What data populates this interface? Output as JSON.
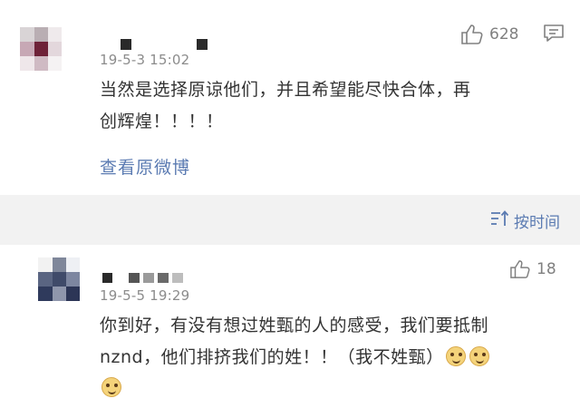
{
  "comments": [
    {
      "time": "19-5-3 15:02",
      "like_count": "628",
      "text_line1": "当然是选择原谅他们，并且希望能尽快合体，再",
      "text_line2": "创辉煌！！！！",
      "view_original_label": "查看原微博"
    },
    {
      "time": "19-5-5 19:29",
      "like_count": "18",
      "text_line1": "你到好，有没有想过姓甄的人的感受，我们要抵制",
      "text_line2": "nznd，他们排挤我们的姓！！（我不姓甄）"
    }
  ],
  "sort_bar": {
    "label": "按时间"
  },
  "icons": [
    "thumbs-up-icon",
    "comment-icon",
    "sort-icon",
    "doge-emoji-icon"
  ],
  "colors": {
    "link": "#5b7bb2",
    "muted": "#8c8c8c",
    "text": "#333333",
    "background": "#f2f2f2"
  }
}
